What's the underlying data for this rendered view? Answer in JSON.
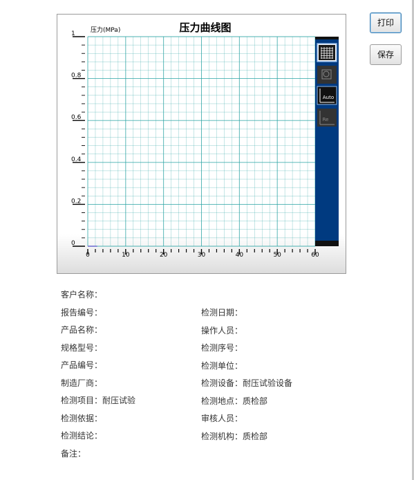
{
  "toolbar": {
    "print_label": "打印",
    "save_label": "保存"
  },
  "chart_data": {
    "type": "line",
    "title": "压力曲线图",
    "ylabel": "压力(MPa)",
    "xlabel": "",
    "xlim": [
      0,
      60
    ],
    "ylim": [
      0,
      1
    ],
    "x_ticks": [
      "0",
      "10",
      "20",
      "30",
      "40",
      "50",
      "60"
    ],
    "y_ticks": [
      "0",
      "0.2",
      "0.4",
      "0.6",
      "0.8",
      "1"
    ],
    "grid": true,
    "grid_color": "#29a3a3",
    "series": [
      {
        "x": [
          0,
          2.5
        ],
        "y": [
          0,
          0
        ]
      }
    ],
    "toolbar_icons": [
      "grid-toggle-icon",
      "zoom-box-icon",
      "auto-scale-icon",
      "reset-zoom-icon"
    ],
    "toolbar_icon_labels": {
      "auto": "Auto",
      "reset": "Re"
    },
    "sidebar_color": "#003a80"
  },
  "report": {
    "left": [
      {
        "label": "客户名称：",
        "value": ""
      },
      {
        "label": "报告编号：",
        "value": ""
      },
      {
        "label": "产品名称：",
        "value": ""
      },
      {
        "label": "规格型号：",
        "value": ""
      },
      {
        "label": "产品编号：",
        "value": ""
      },
      {
        "label": "制造厂商：",
        "value": ""
      },
      {
        "label": "检测项目：",
        "value": "耐压试验"
      },
      {
        "label": "检测依据：",
        "value": ""
      },
      {
        "label": "检测结论：",
        "value": ""
      },
      {
        "label": "备注：",
        "value": ""
      }
    ],
    "right": [
      {
        "label": "检测日期：",
        "value": ""
      },
      {
        "label": "操作人员：",
        "value": ""
      },
      {
        "label": "检测序号：",
        "value": ""
      },
      {
        "label": "检测单位：",
        "value": ""
      },
      {
        "label": "检测设备：",
        "value": "耐压试验设备"
      },
      {
        "label": "检测地点：",
        "value": "质检部"
      },
      {
        "label": "审核人员：",
        "value": ""
      },
      {
        "label": "检测机构：",
        "value": "质检部"
      }
    ]
  }
}
